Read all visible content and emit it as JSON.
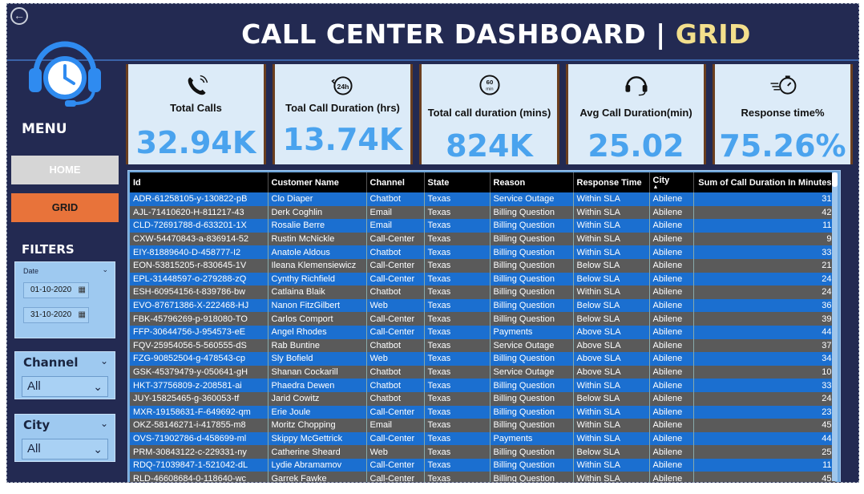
{
  "header": {
    "title_main": "CALL CENTER DASHBOARD | ",
    "title_accent": "GRID"
  },
  "sidebar": {
    "menu_label": "MENU",
    "home_label": "HOME",
    "grid_label": "GRID",
    "filters_label": "FILTERS",
    "date": {
      "label": "Date",
      "start": "01-10-2020",
      "end": "31-10-2020"
    },
    "channel": {
      "label": "Channel",
      "value": "All"
    },
    "city": {
      "label": "City",
      "value": "All"
    }
  },
  "kpis": [
    {
      "name": "Total Calls",
      "value": "32.94K",
      "icon": "phone-icon"
    },
    {
      "name": "Toal Call Duration (hrs)",
      "value": "13.74K",
      "icon": "24h-clock-icon"
    },
    {
      "name": "Total call duration (mins)",
      "value": "824K",
      "icon": "60-min-timer-icon"
    },
    {
      "name": "Avg Call Duration(min)",
      "value": "25.02",
      "icon": "headset-icon"
    },
    {
      "name": "Response time%",
      "value": "75.26%",
      "icon": "stopwatch-icon"
    }
  ],
  "table": {
    "columns": [
      "Id",
      "Customer Name",
      "Channel",
      "State",
      "Reason",
      "Response Time",
      "City",
      "Sum of Call Duration In Minutes"
    ],
    "rows": [
      [
        "ADR-61258105-y-130822-pB",
        "Clo Diaper",
        "Chatbot",
        "Texas",
        "Service Outage",
        "Within SLA",
        "Abilene",
        "31"
      ],
      [
        "AJL-71410620-H-811217-43",
        "Derk Coghlin",
        "Email",
        "Texas",
        "Billing Question",
        "Within SLA",
        "Abilene",
        "42"
      ],
      [
        "CLD-72691788-d-633201-1X",
        "Rosalie Berre",
        "Email",
        "Texas",
        "Billing Question",
        "Within SLA",
        "Abilene",
        "11"
      ],
      [
        "CXW-54470843-a-836914-52",
        "Rustin McNickle",
        "Call-Center",
        "Texas",
        "Billing Question",
        "Within SLA",
        "Abilene",
        "9"
      ],
      [
        "EIY-81889640-D-458777-I2",
        "Anatole Aldous",
        "Chatbot",
        "Texas",
        "Billing Question",
        "Within SLA",
        "Abilene",
        "33"
      ],
      [
        "EON-53815205-r-830645-1V",
        "Ileana Klemensiewicz",
        "Call-Center",
        "Texas",
        "Billing Question",
        "Below SLA",
        "Abilene",
        "21"
      ],
      [
        "EPL-31448597-o-279288-zQ",
        "Cynthy Richfield",
        "Call-Center",
        "Texas",
        "Billing Question",
        "Below SLA",
        "Abilene",
        "24"
      ],
      [
        "ESH-60954156-t-839786-bw",
        "Catlaina Blaik",
        "Chatbot",
        "Texas",
        "Billing Question",
        "Within SLA",
        "Abilene",
        "24"
      ],
      [
        "EVO-87671386-X-222468-HJ",
        "Nanon FitzGilbert",
        "Web",
        "Texas",
        "Billing Question",
        "Below SLA",
        "Abilene",
        "36"
      ],
      [
        "FBK-45796269-p-918080-TO",
        "Carlos Comport",
        "Call-Center",
        "Texas",
        "Billing Question",
        "Below SLA",
        "Abilene",
        "39"
      ],
      [
        "FFP-30644756-J-954573-eE",
        "Angel Rhodes",
        "Call-Center",
        "Texas",
        "Payments",
        "Above SLA",
        "Abilene",
        "44"
      ],
      [
        "FQV-25954056-5-560555-dS",
        "Rab Buntine",
        "Chatbot",
        "Texas",
        "Service Outage",
        "Above SLA",
        "Abilene",
        "37"
      ],
      [
        "FZG-90852504-g-478543-cp",
        "Sly Bofield",
        "Web",
        "Texas",
        "Billing Question",
        "Above SLA",
        "Abilene",
        "34"
      ],
      [
        "GSK-45379479-y-050641-gH",
        "Shanan Cockarill",
        "Chatbot",
        "Texas",
        "Service Outage",
        "Above SLA",
        "Abilene",
        "10"
      ],
      [
        "HKT-37756809-z-208581-ai",
        "Phaedra Dewen",
        "Chatbot",
        "Texas",
        "Billing Question",
        "Within SLA",
        "Abilene",
        "33"
      ],
      [
        "JUY-15825465-g-360053-tf",
        "Jarid Cowitz",
        "Chatbot",
        "Texas",
        "Billing Question",
        "Below SLA",
        "Abilene",
        "24"
      ],
      [
        "MXR-19158631-F-649692-qm",
        "Erie Joule",
        "Call-Center",
        "Texas",
        "Billing Question",
        "Within SLA",
        "Abilene",
        "23"
      ],
      [
        "OKZ-58146271-i-417855-m8",
        "Moritz Chopping",
        "Email",
        "Texas",
        "Billing Question",
        "Within SLA",
        "Abilene",
        "45"
      ],
      [
        "OVS-71902786-d-458699-ml",
        "Skippy McGettrick",
        "Call-Center",
        "Texas",
        "Payments",
        "Within SLA",
        "Abilene",
        "44"
      ],
      [
        "PRM-30843122-c-229331-ny",
        "Catherine Sheard",
        "Web",
        "Texas",
        "Billing Question",
        "Below SLA",
        "Abilene",
        "25"
      ],
      [
        "RDQ-71039847-1-521042-dL",
        "Lydie Abramamov",
        "Call-Center",
        "Texas",
        "Billing Question",
        "Within SLA",
        "Abilene",
        "11"
      ],
      [
        "RLD-46608684-0-118640-wc",
        "Garrek Fawke",
        "Call-Center",
        "Texas",
        "Billing Question",
        "Within SLA",
        "Abilene",
        "45"
      ]
    ]
  }
}
